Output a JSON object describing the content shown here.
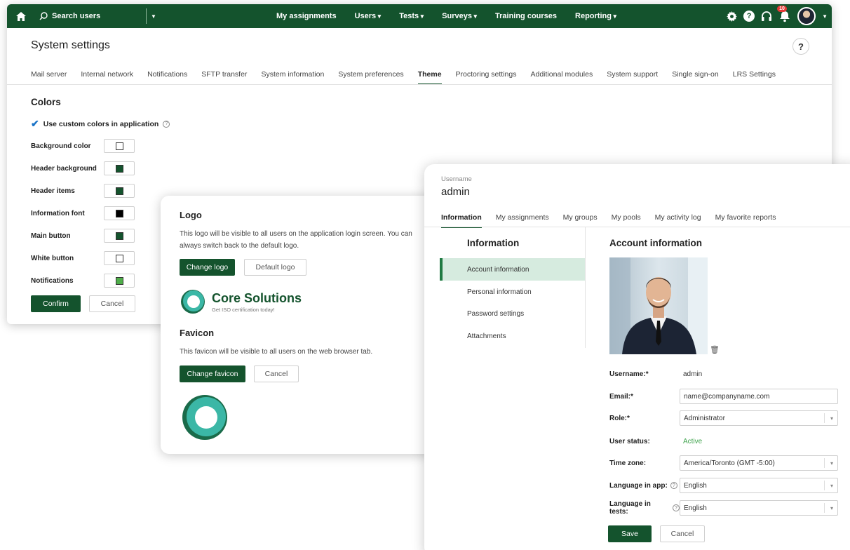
{
  "topbar": {
    "search_placeholder": "Search users",
    "nav": [
      "My assignments",
      "Users",
      "Tests",
      "Surveys",
      "Training courses",
      "Reporting"
    ],
    "notification_count": "10",
    "help_glyph": "?",
    "accent": "#14532d"
  },
  "settings": {
    "title": "System settings",
    "help": "?",
    "tabs": [
      "Mail server",
      "Internal network",
      "Notifications",
      "SFTP transfer",
      "System information",
      "System preferences",
      "Theme",
      "Proctoring settings",
      "Additional modules",
      "System support",
      "Single sign-on",
      "LRS Settings"
    ],
    "active_tab": "Theme",
    "colors_title": "Colors",
    "custom_colors_label": "Use custom colors in application",
    "color_rows": [
      {
        "label": "Background color",
        "color": "#ffffff"
      },
      {
        "label": "Header background",
        "color": "#14532d"
      },
      {
        "label": "Header items",
        "color": "#14532d"
      },
      {
        "label": "Information font",
        "color": "#000000"
      },
      {
        "label": "Main button",
        "color": "#14532d"
      },
      {
        "label": "White button",
        "color": "#ffffff"
      },
      {
        "label": "Notifications",
        "color": "#4fae4a"
      }
    ],
    "confirm_label": "Confirm",
    "cancel_label": "Cancel"
  },
  "logo_card": {
    "logo_title": "Logo",
    "logo_text": "This logo will be visible to all users on the application login screen. You can always switch back to the default logo.",
    "change_logo": "Change logo",
    "default_logo": "Default logo",
    "brand_name": "Core Solutions",
    "brand_tagline": "Get ISO certification today!",
    "favicon_title": "Favicon",
    "favicon_text": "This favicon will be visible to all users on the web browser tab.",
    "change_favicon": "Change favicon",
    "cancel_label": "Cancel"
  },
  "profile": {
    "username_label": "Username",
    "username": "admin",
    "tabs": [
      "Information",
      "My assignments",
      "My groups",
      "My pools",
      "My activity log",
      "My favorite reports"
    ],
    "active_tab": "Information",
    "side_title": "Information",
    "side_items": [
      "Account information",
      "Personal information",
      "Password settings",
      "Attachments"
    ],
    "active_side": "Account information",
    "account_title": "Account information",
    "fields": {
      "username_label": "Username:*",
      "username_value": "admin",
      "email_label": "Email:*",
      "email_value": "name@companyname.com",
      "role_label": "Role:*",
      "role_value": "Administrator",
      "status_label": "User status:",
      "status_value": "Active",
      "timezone_label": "Time zone:",
      "timezone_value": "America/Toronto (GMT -5:00)",
      "lang_app_label": "Language in app:",
      "lang_app_value": "English",
      "lang_tests_label": "Language in tests:",
      "lang_tests_value": "English"
    },
    "save_label": "Save",
    "cancel_label": "Cancel"
  }
}
